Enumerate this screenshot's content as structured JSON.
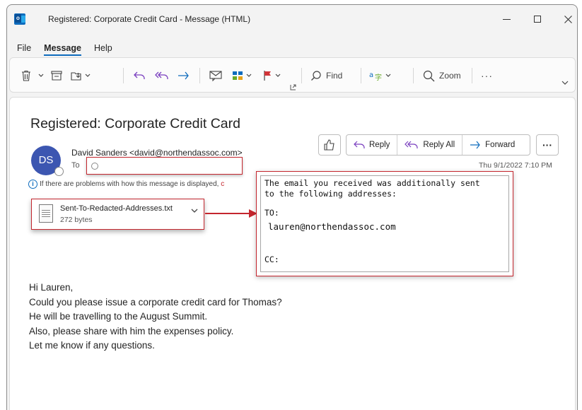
{
  "window": {
    "title": "Registered: Corporate Credit Card - Message (HTML)",
    "app_icon_letter": "o"
  },
  "menu": {
    "items": [
      "File",
      "Message",
      "Help"
    ],
    "active": "Message"
  },
  "ribbon": {
    "find_label": "Find",
    "zoom_label": "Zoom",
    "more_label": "···"
  },
  "message": {
    "subject": "Registered: Corporate Credit Card",
    "avatar_initials": "DS",
    "sender": "David Sanders <david@northendassoc.com>",
    "to_label": "To",
    "info_text": "If there are problems with how this message is displayed,",
    "info_more": "c",
    "date": "Thu 9/1/2022 7:10 PM",
    "actions": {
      "reply": "Reply",
      "reply_all": "Reply All",
      "forward": "Forward",
      "more": "···"
    },
    "attachment": {
      "name": "Sent-To-Redacted-Addresses.txt",
      "size": "272 bytes"
    },
    "body_lines": [
      "Hi Lauren,",
      "Could you please issue a corporate credit card for Thomas?",
      "He will be travelling to the August Summit.",
      "Also, please share with him the expenses policy.",
      "Let me know if any questions."
    ]
  },
  "popup": {
    "line1": "The email you received was additionally sent",
    "line2": "to the following addresses:",
    "to_label": "TO:",
    "to_address": "lauren@northendassoc.com",
    "cc_label": "CC:"
  },
  "colors": {
    "accent": "#0f6cbd",
    "avatar": "#3c56b1",
    "highlight": "#c4262e"
  }
}
